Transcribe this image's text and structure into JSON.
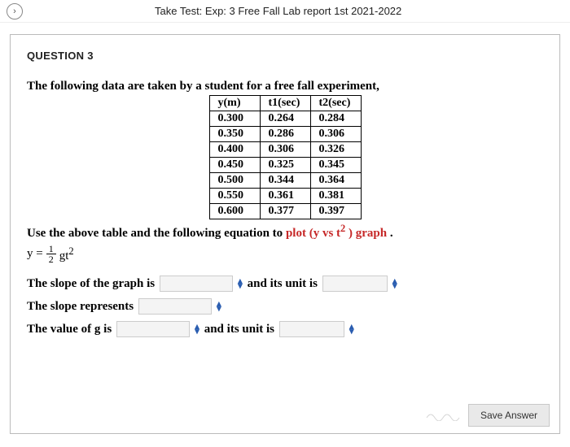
{
  "topbar": {
    "back_icon": "›",
    "title": "Take Test: Exp: 3 Free Fall Lab report 1st 2021-2022"
  },
  "question": {
    "heading": "QUESTION 3",
    "intro": "The following data are taken by a student for a free fall experiment,",
    "table": {
      "headers": [
        "y(m)",
        "t1(sec)",
        "t2(sec)"
      ],
      "rows": [
        [
          "0.300",
          "0.264",
          "0.284"
        ],
        [
          "0.350",
          "0.286",
          "0.306"
        ],
        [
          "0.400",
          "0.306",
          "0.326"
        ],
        [
          "0.450",
          "0.325",
          "0.345"
        ],
        [
          "0.500",
          "0.344",
          "0.364"
        ],
        [
          "0.550",
          "0.361",
          "0.381"
        ],
        [
          "0.600",
          "0.377",
          "0.397"
        ]
      ]
    },
    "instruction_prefix": "Use the above table and the following equation to ",
    "instruction_red": "plot (y vs t",
    "instruction_red_sup": "2",
    "instruction_red_suffix": " ) graph",
    "instruction_period": "  .",
    "formula": {
      "lhs": "y =",
      "frac_num": "1",
      "frac_den": "2",
      "rhs": "gt",
      "sup": "2"
    },
    "lines": {
      "slope_prefix": "The slope of the graph is",
      "slope_mid": "and its unit is",
      "represents": "The slope represents",
      "g_prefix": "The value of  g is",
      "g_mid": "and its unit is"
    }
  },
  "footer": {
    "save_label": "Save Answer"
  },
  "chart_data": {
    "type": "table",
    "title": "Free fall experiment data",
    "columns": [
      "y(m)",
      "t1(sec)",
      "t2(sec)"
    ],
    "rows": [
      [
        0.3,
        0.264,
        0.284
      ],
      [
        0.35,
        0.286,
        0.306
      ],
      [
        0.4,
        0.306,
        0.326
      ],
      [
        0.45,
        0.325,
        0.345
      ],
      [
        0.5,
        0.344,
        0.364
      ],
      [
        0.55,
        0.361,
        0.381
      ],
      [
        0.6,
        0.377,
        0.397
      ]
    ]
  }
}
